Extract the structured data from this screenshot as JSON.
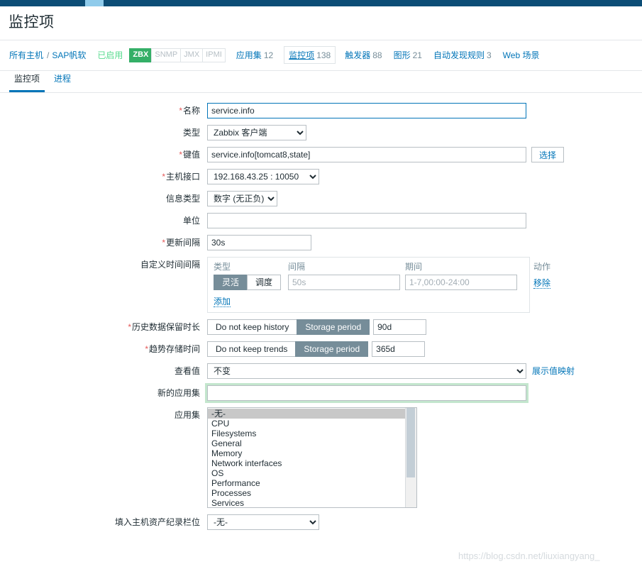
{
  "page": {
    "title": "监控项"
  },
  "breadcrumb": {
    "all_hosts": "所有主机",
    "separator": "/",
    "host": "SAP帆软",
    "status": "已启用",
    "protocols": [
      {
        "label": "ZBX",
        "active": true
      },
      {
        "label": "SNMP",
        "active": false
      },
      {
        "label": "JMX",
        "active": false
      },
      {
        "label": "IPMI",
        "active": false
      }
    ],
    "tabs": [
      {
        "label": "应用集",
        "count": "12",
        "selected": false
      },
      {
        "label": "监控项",
        "count": "138",
        "selected": true
      },
      {
        "label": "触发器",
        "count": "88",
        "selected": false
      },
      {
        "label": "图形",
        "count": "21",
        "selected": false
      },
      {
        "label": "自动发现规则",
        "count": "3",
        "selected": false
      },
      {
        "label": "Web 场景",
        "count": "",
        "selected": false
      }
    ]
  },
  "object_tabs": [
    {
      "label": "监控项",
      "active": true
    },
    {
      "label": "进程",
      "active": false
    }
  ],
  "form": {
    "name": {
      "label": "名称",
      "required": true,
      "value": "service.info"
    },
    "type": {
      "label": "类型",
      "required": false,
      "value": "Zabbix 客户端",
      "options": [
        "Zabbix 客户端"
      ]
    },
    "key": {
      "label": "键值",
      "required": true,
      "value": "service.info[tomcat8,state]",
      "select_button": "选择"
    },
    "host_interface": {
      "label": "主机接口",
      "required": true,
      "value": "192.168.43.25 : 10050",
      "options": [
        "192.168.43.25 : 10050"
      ]
    },
    "value_type": {
      "label": "信息类型",
      "required": false,
      "value": "数字 (无正负)",
      "options": [
        "数字 (无正负)"
      ]
    },
    "units": {
      "label": "单位",
      "required": false,
      "value": ""
    },
    "update_interval": {
      "label": "更新间隔",
      "required": true,
      "value": "30s"
    },
    "custom_intervals": {
      "label": "自定义时间间隔",
      "headers": {
        "type": "类型",
        "interval": "间隔",
        "period": "期间",
        "action": "动作"
      },
      "rows": [
        {
          "type_flexible": "灵活",
          "type_scheduling": "调度",
          "type_selected": "灵活",
          "interval_value": "",
          "interval_placeholder": "50s",
          "period_value": "",
          "period_placeholder": "1-7,00:00-24:00",
          "remove_label": "移除"
        }
      ],
      "add_label": "添加"
    },
    "history": {
      "label": "历史数据保留时长",
      "required": true,
      "option_off": "Do not keep history",
      "option_on": "Storage period",
      "selected": "Storage period",
      "value": "90d"
    },
    "trends": {
      "label": "趋势存储时间",
      "required": true,
      "option_off": "Do not keep trends",
      "option_on": "Storage period",
      "selected": "Storage period",
      "value": "365d"
    },
    "show_value": {
      "label": "查看值",
      "required": false,
      "value": "不变",
      "options": [
        "不变"
      ],
      "link": "展示值映射"
    },
    "new_application": {
      "label": "新的应用集",
      "required": false,
      "value": ""
    },
    "applications": {
      "label": "应用集",
      "options": [
        {
          "label": "-无-",
          "selected": true
        },
        {
          "label": "CPU",
          "selected": false
        },
        {
          "label": "Filesystems",
          "selected": false
        },
        {
          "label": "General",
          "selected": false
        },
        {
          "label": "Memory",
          "selected": false
        },
        {
          "label": "Network interfaces",
          "selected": false
        },
        {
          "label": "OS",
          "selected": false
        },
        {
          "label": "Performance",
          "selected": false
        },
        {
          "label": "Processes",
          "selected": false
        },
        {
          "label": "Services",
          "selected": false
        }
      ]
    },
    "inventory_field": {
      "label": "填入主机资产纪录栏位",
      "required": false,
      "value": "-无-",
      "options": [
        "-无-"
      ]
    }
  },
  "watermark": "https://blog.csdn.net/liuxiangyang_",
  "colors": {
    "topbar": "#0c4d76",
    "topbar_marker": "#8fcbeb",
    "link": "#0275b8",
    "enabled_green": "#59db8f",
    "badge_green": "#34af67",
    "segment_selected": "#768d99",
    "required_red": "#e45959"
  }
}
